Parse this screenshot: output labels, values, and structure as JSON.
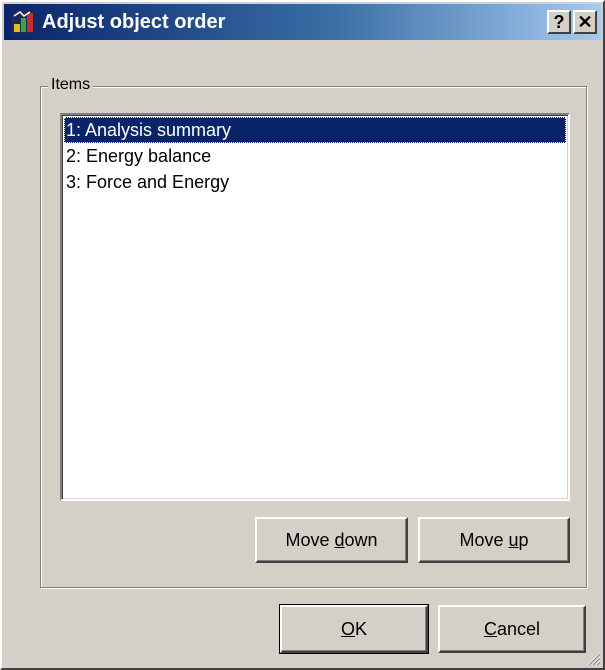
{
  "window": {
    "title": "Adjust object order",
    "help_icon": "help-question-icon",
    "close_icon": "close-x-icon",
    "help_label": "?",
    "close_label": "✕"
  },
  "items_group": {
    "label": "Items",
    "list": [
      {
        "label": "1: Analysis summary",
        "selected": true
      },
      {
        "label": "2: Energy balance",
        "selected": false
      },
      {
        "label": "3: Force and Energy",
        "selected": false
      }
    ]
  },
  "buttons": {
    "move_down": {
      "prefix": "Move ",
      "hotkey": "d",
      "suffix": "own"
    },
    "move_up": {
      "prefix": "Move ",
      "hotkey": "u",
      "suffix": "p"
    },
    "ok": {
      "prefix": "",
      "hotkey": "O",
      "suffix": "K"
    },
    "cancel": {
      "prefix": "",
      "hotkey": "C",
      "suffix": "ancel"
    }
  },
  "colors": {
    "titlebar_start": "#0a246a",
    "titlebar_end": "#a6caf0",
    "selection": "#0a246a",
    "face": "#d4d0c8"
  }
}
